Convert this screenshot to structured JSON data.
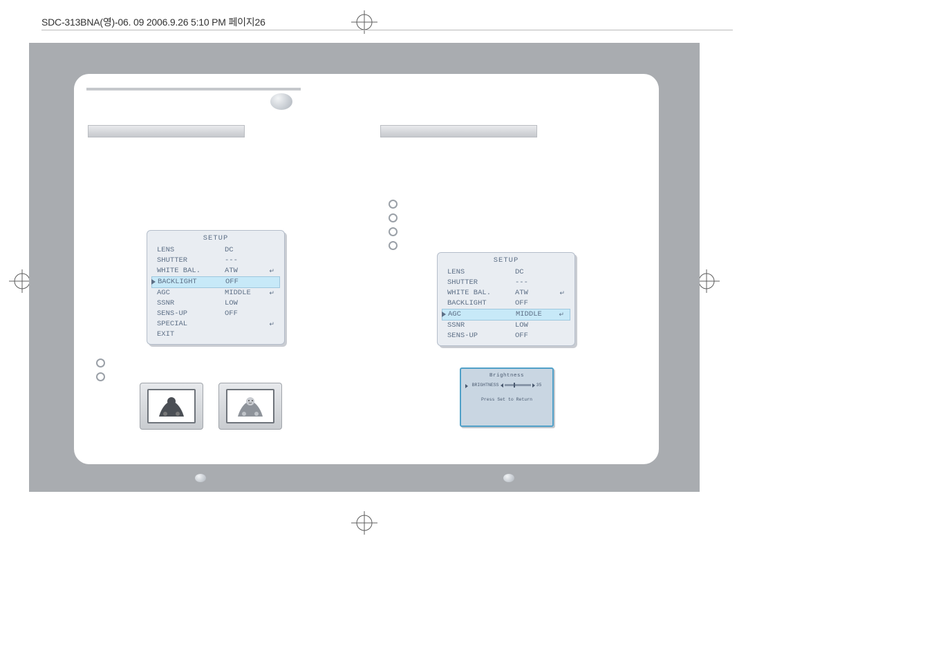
{
  "slug": "SDC-313BNA(영)-06. 09  2006.9.26 5:10 PM  페이지26",
  "left_menu": {
    "title": "SETUP",
    "selected_index": 3,
    "rows": [
      {
        "label": "LENS",
        "value": "DC",
        "enter": false
      },
      {
        "label": "SHUTTER",
        "value": "---",
        "enter": false
      },
      {
        "label": "WHITE BAL.",
        "value": "ATW",
        "enter": true
      },
      {
        "label": "BACKLIGHT",
        "value": "OFF",
        "enter": false
      },
      {
        "label": "AGC",
        "value": "MIDDLE",
        "enter": true
      },
      {
        "label": "SSNR",
        "value": "LOW",
        "enter": false
      },
      {
        "label": "SENS-UP",
        "value": "OFF",
        "enter": false
      },
      {
        "label": "SPECIAL",
        "value": "",
        "enter": true
      },
      {
        "label": "EXIT",
        "value": "",
        "enter": false
      }
    ]
  },
  "right_menu": {
    "title": "SETUP",
    "selected_index": 4,
    "rows": [
      {
        "label": "LENS",
        "value": "DC",
        "enter": false
      },
      {
        "label": "SHUTTER",
        "value": "---",
        "enter": false
      },
      {
        "label": "WHITE BAL.",
        "value": "ATW",
        "enter": true
      },
      {
        "label": "BACKLIGHT",
        "value": "OFF",
        "enter": false
      },
      {
        "label": "AGC",
        "value": "MIDDLE",
        "enter": true
      },
      {
        "label": "SSNR",
        "value": "LOW",
        "enter": false
      },
      {
        "label": "SENS-UP",
        "value": "OFF",
        "enter": false
      }
    ]
  },
  "brightness": {
    "title": "Brightness",
    "label": "BRIGHTNESS",
    "value": "35",
    "return": "Press Set to Return"
  },
  "left_bullets_count": 2,
  "right_bullets_count": 4,
  "enter_glyph": "↵"
}
